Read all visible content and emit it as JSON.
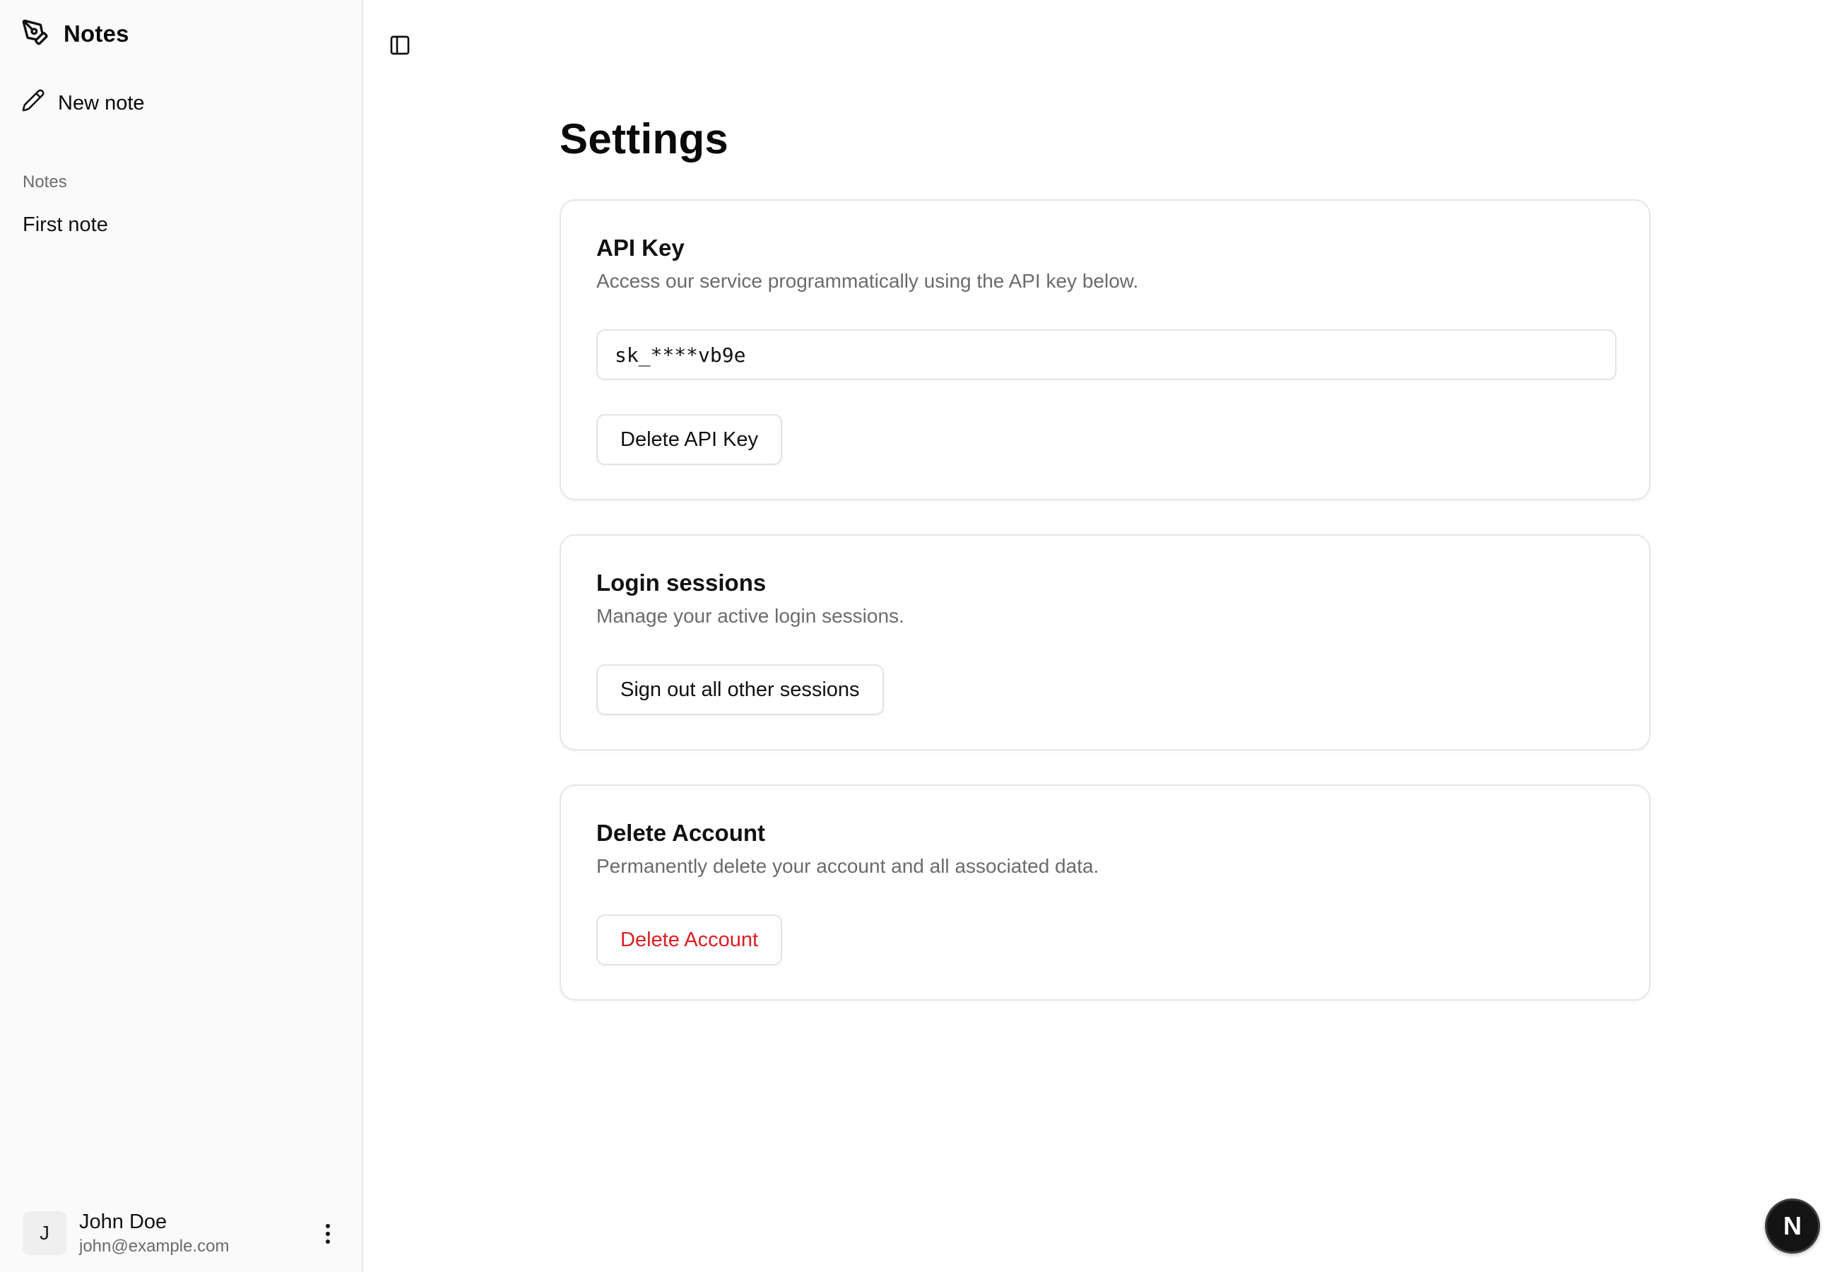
{
  "sidebar": {
    "brand_title": "Notes",
    "brand_icon": "pen-nib-icon",
    "new_note_label": "New note",
    "section_label": "Notes",
    "notes": [
      {
        "title": "First note"
      }
    ],
    "user": {
      "initial": "J",
      "name": "John Doe",
      "email": "john@example.com"
    }
  },
  "main": {
    "page_title": "Settings",
    "api_key_card": {
      "title": "API Key",
      "description": "Access our service programmatically using the API key below.",
      "api_key_value": "sk_****vb9e",
      "delete_button_label": "Delete API Key"
    },
    "sessions_card": {
      "title": "Login sessions",
      "description": "Manage your active login sessions.",
      "sign_out_button_label": "Sign out all other sessions"
    },
    "delete_account_card": {
      "title": "Delete Account",
      "description": "Permanently delete your account and all associated data.",
      "delete_button_label": "Delete Account"
    }
  },
  "dev_indicator": {
    "label": "N"
  },
  "colors": {
    "danger": "#dc1d22",
    "sidebar_bg": "#fafafa",
    "muted_text": "#6b6b6b"
  }
}
